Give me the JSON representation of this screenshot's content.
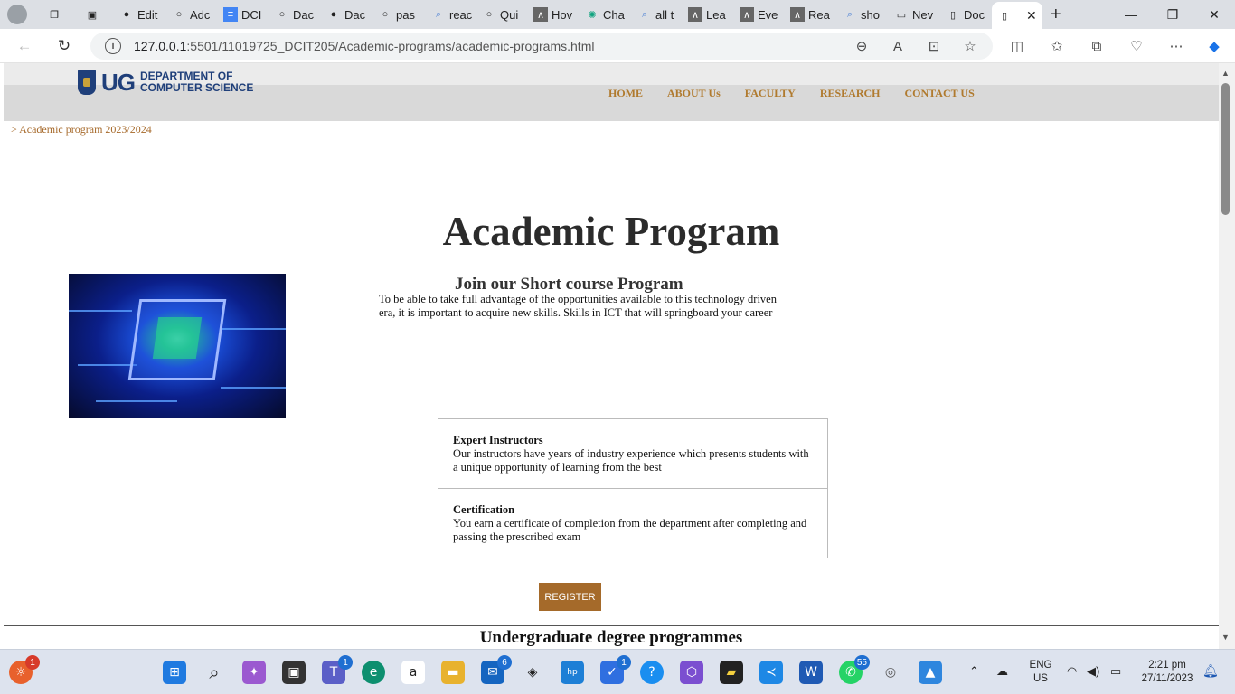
{
  "browser": {
    "tabs": [
      {
        "label": "Edit",
        "icon": "github-icon"
      },
      {
        "label": "Adc",
        "icon": "github-icon"
      },
      {
        "label": "DCI",
        "icon": "docs-icon"
      },
      {
        "label": "Dac",
        "icon": "github-icon"
      },
      {
        "label": "Dac",
        "icon": "github-icon"
      },
      {
        "label": "pas",
        "icon": "github-icon"
      },
      {
        "label": "reac",
        "icon": "search-icon"
      },
      {
        "label": "Qui",
        "icon": "github-icon"
      },
      {
        "label": "Hov",
        "icon": "app-icon"
      },
      {
        "label": "Cha",
        "icon": "chatgpt-icon"
      },
      {
        "label": "all t",
        "icon": "search-icon"
      },
      {
        "label": "Lea",
        "icon": "app-icon"
      },
      {
        "label": "Eve",
        "icon": "app-icon"
      },
      {
        "label": "Rea",
        "icon": "app-icon"
      },
      {
        "label": "sho",
        "icon": "search-icon"
      },
      {
        "label": "Nev",
        "icon": "window-icon"
      },
      {
        "label": "Doc",
        "icon": "page-icon"
      }
    ],
    "url_host": "127.0.0.1",
    "url_path": ":5501/11019725_DCIT205/Academic-programs/academic-programs.html"
  },
  "site": {
    "logo": {
      "ug": "UG",
      "dept_line1": "DEPARTMENT OF",
      "dept_line2": "COMPUTER SCIENCE"
    },
    "nav": [
      "HOME",
      "ABOUT Us",
      "FACULTY",
      "RESEARCH",
      "CONTACT US"
    ],
    "breadcrumb": "> Academic program 2023/2024",
    "page_title": "Academic Program",
    "short_course": {
      "title": "Join our Short course Program",
      "description": "To be able to take full advantage of the opportunities available to this technology driven era, it is important to acquire new skills. Skills in ICT that will springboard your career"
    },
    "features": [
      {
        "title": "Expert Instructors",
        "text": "Our instructors have years of industry experience which presents students with a unique opportunity of learning from the best"
      },
      {
        "title": "Certification",
        "text": "You earn a certificate of completion from the department after completing and passing the prescribed exam"
      }
    ],
    "register_label": "REGISTER",
    "undergrad_title": "Undergraduate degree programmes"
  },
  "taskbar": {
    "badges": {
      "start": "1",
      "teams": "1",
      "mail": "6",
      "todo": "1",
      "whatsapp": "55"
    },
    "lang": "ENG",
    "region": "US",
    "time": "2:21 pm",
    "date": "27/11/2023"
  },
  "colors": {
    "accent": "#a56a2a",
    "nav_link": "#b07a2e",
    "brand_blue": "#1f3f7a"
  }
}
